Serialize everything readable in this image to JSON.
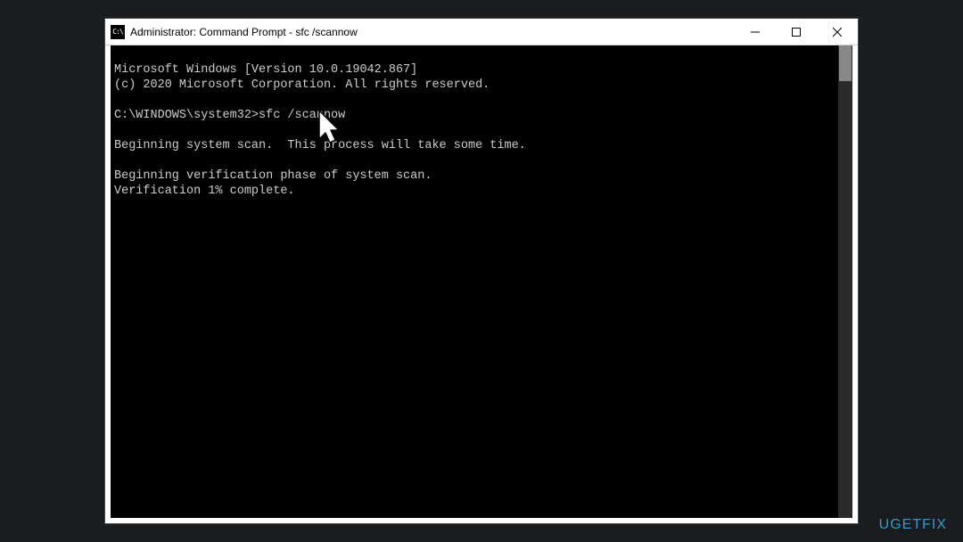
{
  "window": {
    "title": "Administrator: Command Prompt - sfc  /scannow",
    "icon_text": "C:\\",
    "controls": {
      "minimize": "Minimize",
      "maximize": "Maximize",
      "close": "Close"
    }
  },
  "console": {
    "line1": "Microsoft Windows [Version 10.0.19042.867]",
    "line2": "(c) 2020 Microsoft Corporation. All rights reserved.",
    "blank1": "",
    "prompt_line": "C:\\WINDOWS\\system32>sfc /scannow",
    "blank2": "",
    "line3": "Beginning system scan.  This process will take some time.",
    "blank3": "",
    "line4": "Beginning verification phase of system scan.",
    "line5": "Verification 1% complete."
  },
  "watermark": "UGETFIX"
}
